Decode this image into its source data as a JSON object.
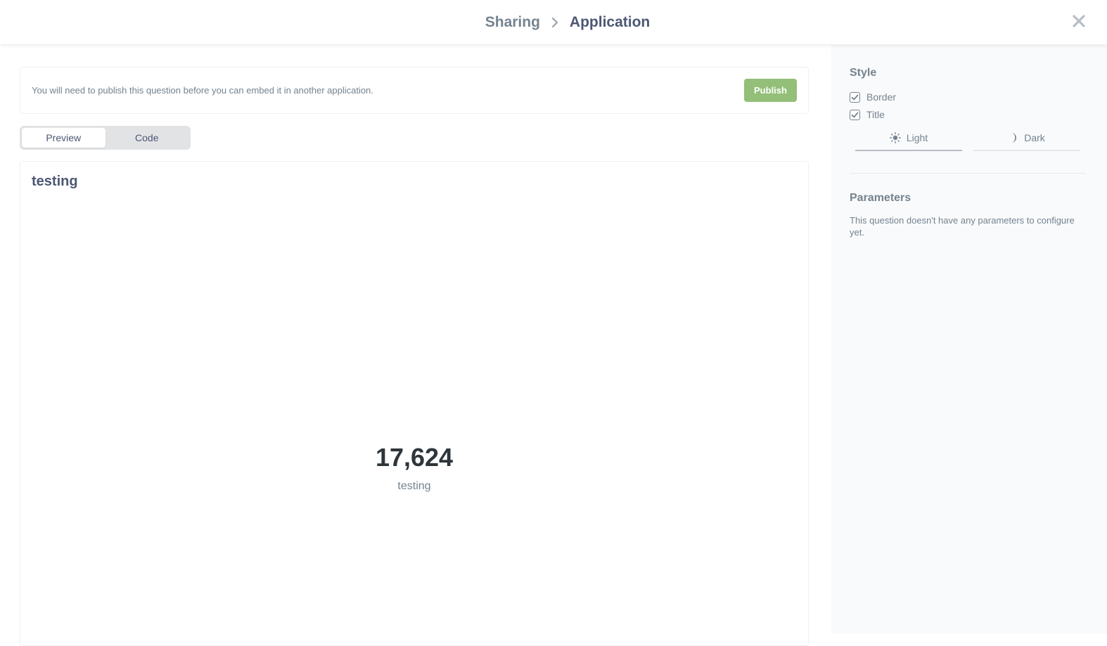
{
  "header": {
    "breadcrumb": [
      "Sharing",
      "Application"
    ],
    "icons": {
      "separator": "chevron-right-icon",
      "close": "close-icon"
    }
  },
  "notice": {
    "text": "You will need to publish this question before you can embed it in another application.",
    "publish_label": "Publish"
  },
  "view_toggle": {
    "options": [
      "Preview",
      "Code"
    ],
    "selected": "Preview"
  },
  "preview": {
    "title": "testing",
    "value": "17,624",
    "label": "testing"
  },
  "sidebar": {
    "style": {
      "title": "Style",
      "options": [
        {
          "label": "Border",
          "checked": true
        },
        {
          "label": "Title",
          "checked": true
        }
      ],
      "themes": [
        {
          "label": "Light",
          "icon": "sun-icon",
          "selected": true
        },
        {
          "label": "Dark",
          "icon": "moon-icon",
          "selected": false
        }
      ]
    },
    "parameters": {
      "title": "Parameters",
      "text": "This question doesn't have any parameters to configure yet."
    }
  },
  "colors": {
    "publish_button": "#93bf78",
    "text_primary": "#4c5773",
    "text_secondary": "#74838f",
    "sidebar_bg": "#f9fafb"
  }
}
